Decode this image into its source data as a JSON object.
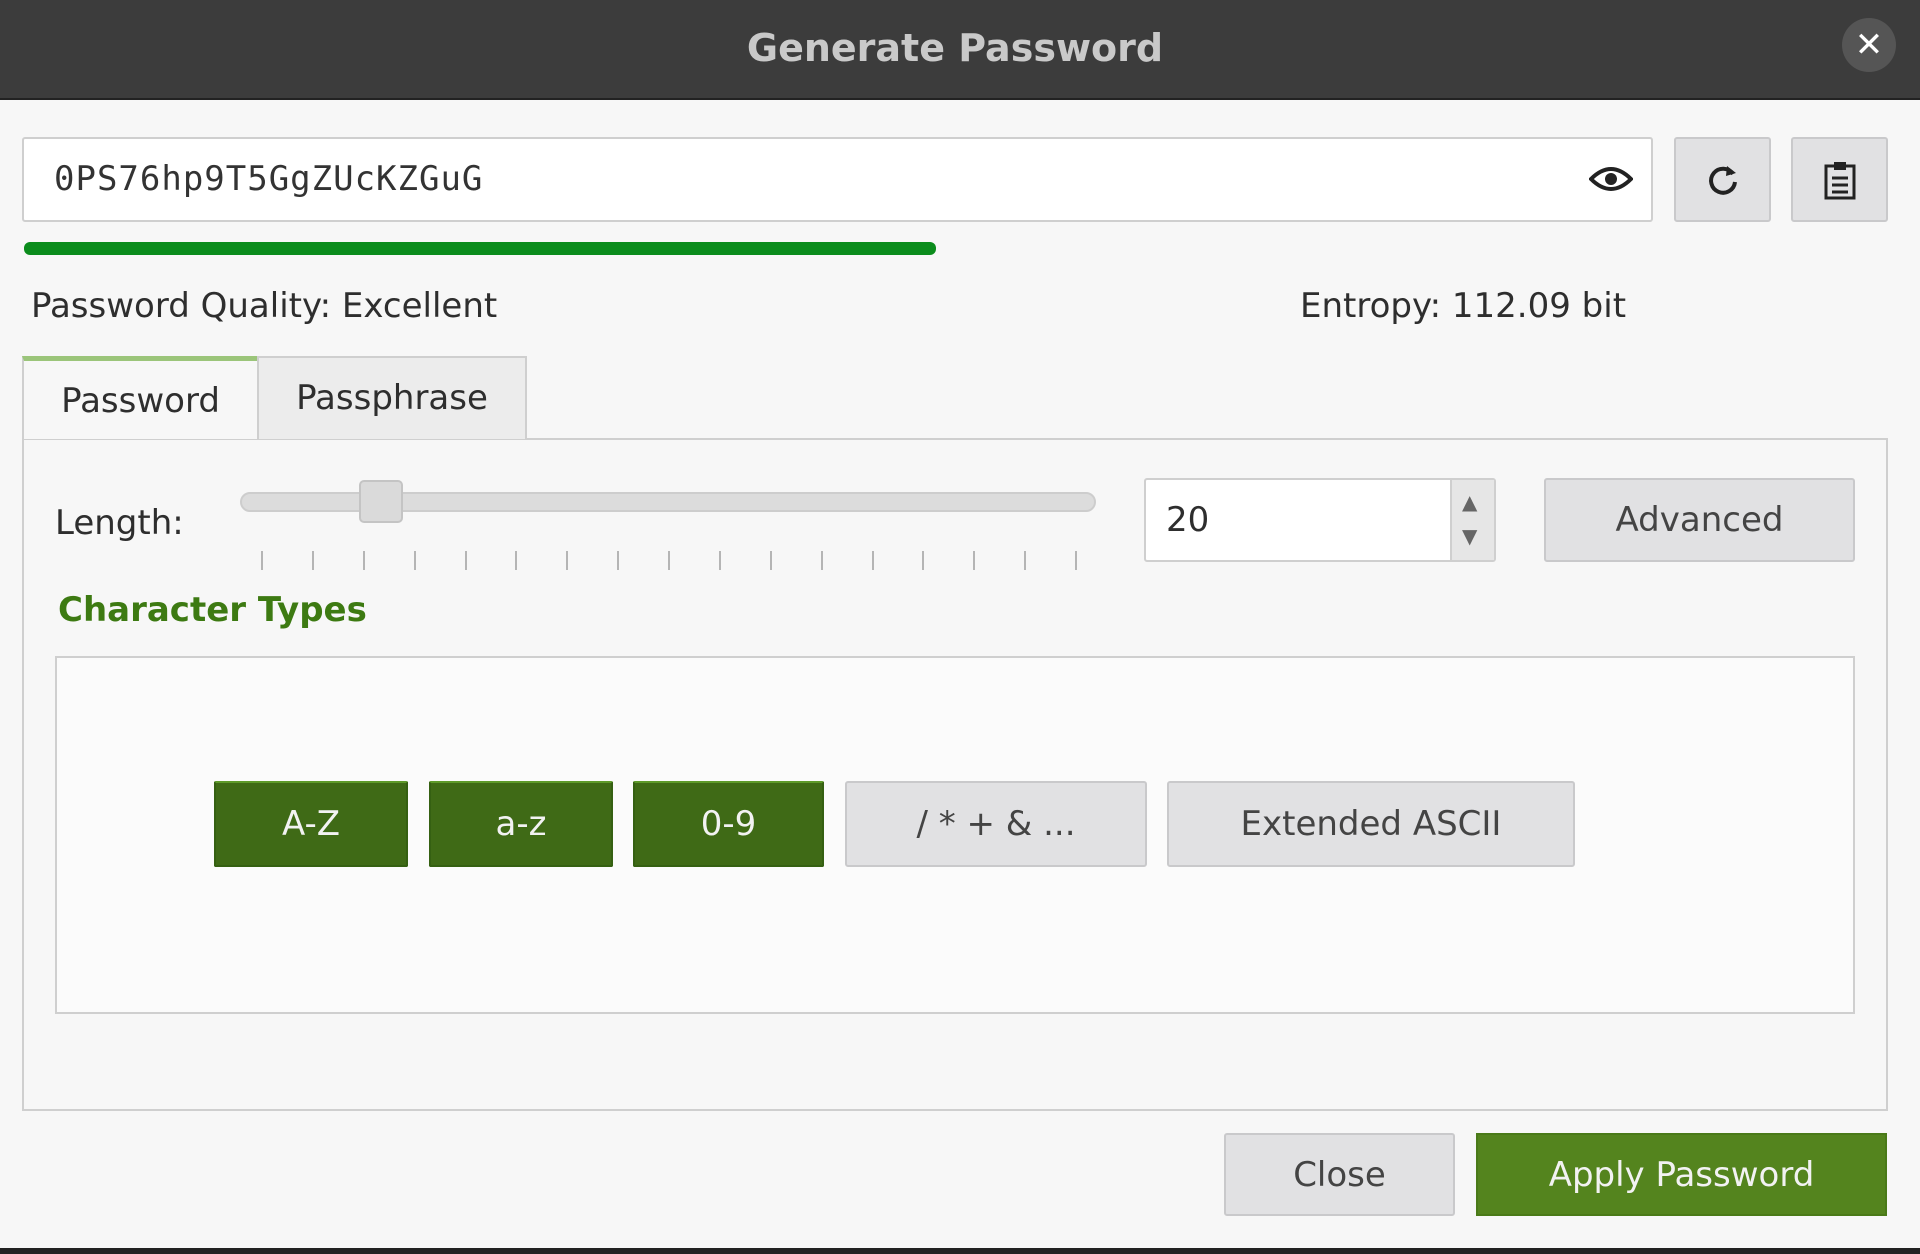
{
  "window": {
    "title": "Generate Password",
    "close_icon": "close-icon"
  },
  "password": {
    "value": "0PS76hp9T5GgZUcKZGuG",
    "toggle_icon": "eye-icon",
    "regenerate_icon": "refresh-icon",
    "copy_icon": "clipboard-icon"
  },
  "strength": {
    "fraction": 0.56,
    "color": "#0b8c1c",
    "quality_label": "Password Quality: Excellent",
    "entropy_label": "Entropy: 112.09 bit"
  },
  "tabs": [
    {
      "label": "Password",
      "active": true
    },
    {
      "label": "Passphrase",
      "active": false
    }
  ],
  "length": {
    "label": "Length:",
    "value": "20",
    "slider_min": 1,
    "slider_max": 128,
    "slider_value": 20
  },
  "advanced_label": "Advanced",
  "character_types": {
    "title": "Character Types",
    "buttons": [
      {
        "label": "A-Z",
        "checked": true
      },
      {
        "label": "a-z",
        "checked": true
      },
      {
        "label": "0-9",
        "checked": true
      },
      {
        "label": "/ * + & ...",
        "checked": false
      },
      {
        "label": "Extended ASCII",
        "checked": false
      }
    ]
  },
  "footer": {
    "close_label": "Close",
    "apply_label": "Apply Password"
  },
  "colors": {
    "accent": "#3f6a16",
    "apply": "#54841e",
    "titlebar": "#3c3c3c"
  }
}
